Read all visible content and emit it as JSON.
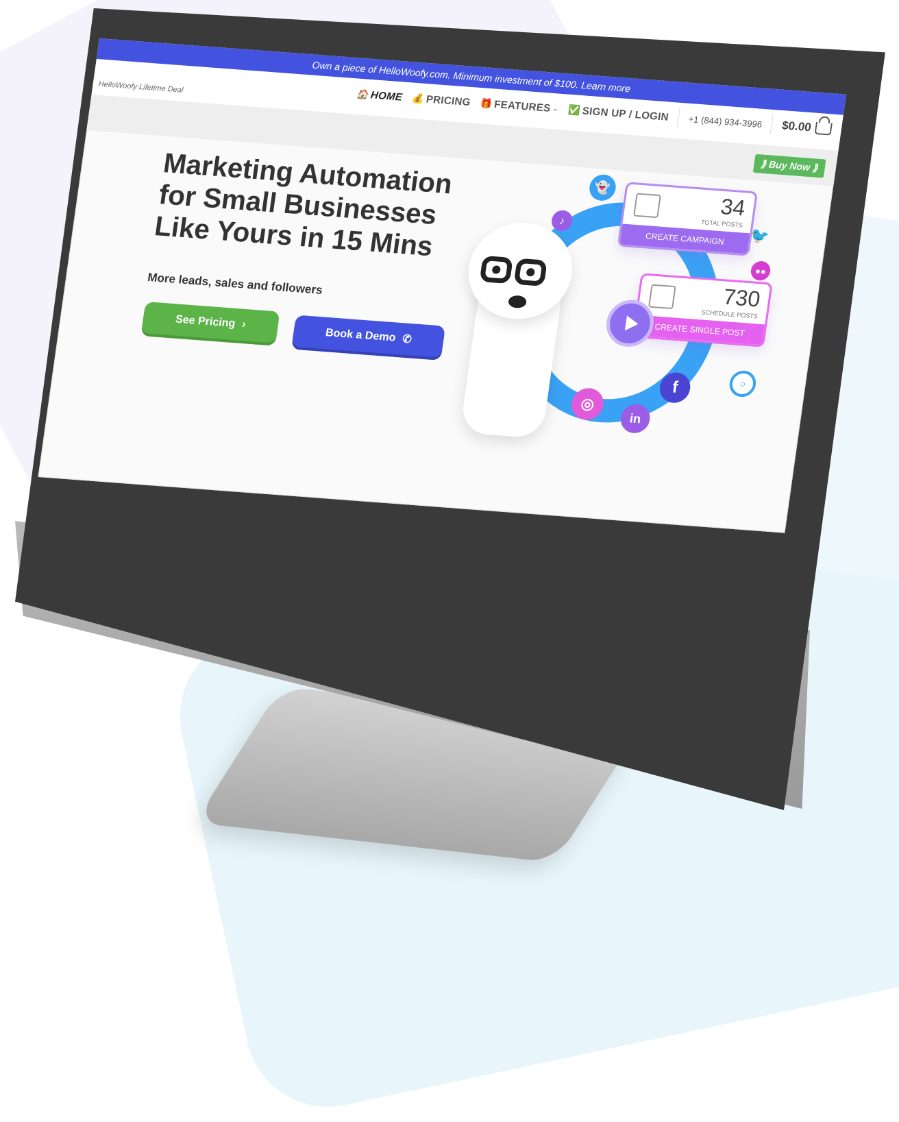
{
  "promo_banner": "Own a piece of HelloWoofy.com. Minimum investment of $100. Learn more",
  "brand": "HelloWoofy Lifetime Deal",
  "nav": {
    "home": "HOME",
    "pricing": "PRICING",
    "features": "FEATURES",
    "signup": "SIGN UP / LOGIN",
    "phone": "+1 (844) 934-3996",
    "cart_total": "$0.00"
  },
  "buy_now": "⟫ Buy Now ⟫",
  "hero": {
    "title": "Marketing Automation for Small Businesses Like Yours in 15 Mins",
    "subtitle": "More leads, sales and followers",
    "pricing_button": "See Pricing",
    "demo_button": "Book a Demo"
  },
  "cards": {
    "campaign_count": "34",
    "campaign_caption": "TOTAL POSTS",
    "campaign_action": "CREATE CAMPAIGN",
    "schedule_count": "730",
    "schedule_caption": "SCHEDULE POSTS",
    "schedule_action": "CREATE SINGLE POST"
  },
  "colors": {
    "primary_blue": "#4353df",
    "green": "#5cb449",
    "ring_blue": "#3aa2f4",
    "purple": "#9c6bf0",
    "magenta": "#e561f0"
  },
  "icons": [
    "home-icon",
    "money-bag-icon",
    "gift-icon",
    "check-icon",
    "cart-icon",
    "snapchat-icon",
    "tiktok-icon",
    "twitter-icon",
    "medium-icon",
    "wordpress-icon",
    "alexa-icon",
    "facebook-icon",
    "linkedin-icon",
    "instagram-icon",
    "phone-icon",
    "play-icon"
  ]
}
